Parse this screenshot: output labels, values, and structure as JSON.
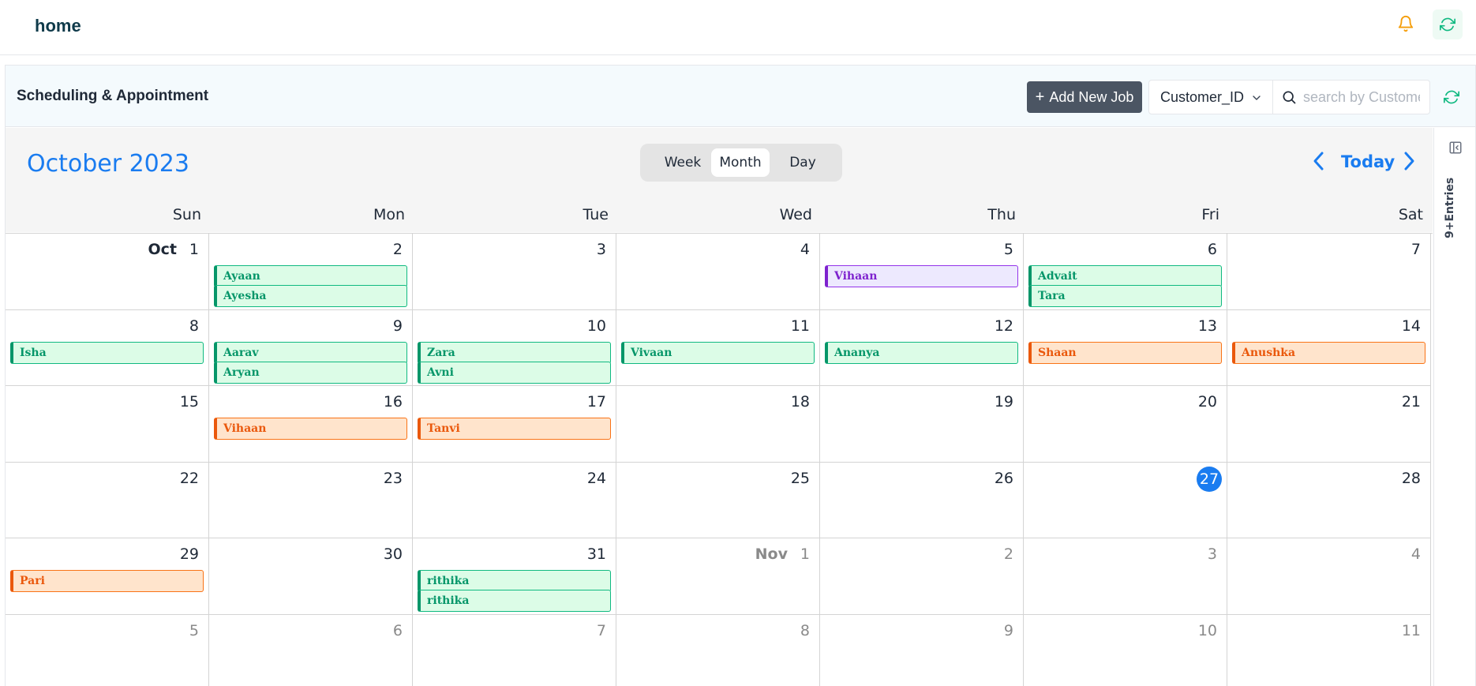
{
  "header": {
    "title": "home",
    "bell_icon": "bell-icon",
    "refresh_icon": "refresh-icon"
  },
  "card": {
    "title": "Scheduling & Appointment",
    "add_button_label": "Add New Job",
    "add_button_icon": "+",
    "filter_select_value": "Customer_ID",
    "search_placeholder": "search by Customer",
    "refresh_icon": "refresh-icon"
  },
  "calendar": {
    "month_title": "October 2023",
    "views": [
      "Week",
      "Month",
      "Day"
    ],
    "active_view": "Month",
    "today_label": "Today",
    "weekdays": [
      "Sun",
      "Mon",
      "Tue",
      "Wed",
      "Thu",
      "Fri",
      "Sat"
    ],
    "weeks": [
      [
        {
          "day": "1",
          "month_label": "Oct",
          "dim": false,
          "events": []
        },
        {
          "day": "2",
          "dim": false,
          "events": [
            {
              "name": "Ayaan",
              "color": "green"
            },
            {
              "name": "Ayesha",
              "color": "green"
            }
          ]
        },
        {
          "day": "3",
          "dim": false,
          "events": []
        },
        {
          "day": "4",
          "dim": false,
          "events": []
        },
        {
          "day": "5",
          "dim": false,
          "events": [
            {
              "name": "Vihaan",
              "color": "purple"
            }
          ]
        },
        {
          "day": "6",
          "dim": false,
          "events": [
            {
              "name": "Advait",
              "color": "green"
            },
            {
              "name": "Tara",
              "color": "green"
            }
          ]
        },
        {
          "day": "7",
          "dim": false,
          "events": []
        }
      ],
      [
        {
          "day": "8",
          "dim": false,
          "events": [
            {
              "name": "Isha",
              "color": "green"
            }
          ]
        },
        {
          "day": "9",
          "dim": false,
          "events": [
            {
              "name": "Aarav",
              "color": "green"
            },
            {
              "name": "Aryan",
              "color": "green"
            }
          ]
        },
        {
          "day": "10",
          "dim": false,
          "events": [
            {
              "name": "Zara",
              "color": "green"
            },
            {
              "name": "Avni",
              "color": "green"
            }
          ]
        },
        {
          "day": "11",
          "dim": false,
          "events": [
            {
              "name": "Vivaan",
              "color": "green"
            }
          ]
        },
        {
          "day": "12",
          "dim": false,
          "events": [
            {
              "name": "Ananya",
              "color": "green"
            }
          ]
        },
        {
          "day": "13",
          "dim": false,
          "events": [
            {
              "name": "Shaan",
              "color": "orange"
            }
          ]
        },
        {
          "day": "14",
          "dim": false,
          "events": [
            {
              "name": "Anushka",
              "color": "orange"
            }
          ]
        }
      ],
      [
        {
          "day": "15",
          "dim": false,
          "events": []
        },
        {
          "day": "16",
          "dim": false,
          "events": [
            {
              "name": "Vihaan",
              "color": "orange"
            }
          ]
        },
        {
          "day": "17",
          "dim": false,
          "events": [
            {
              "name": "Tanvi",
              "color": "orange"
            }
          ]
        },
        {
          "day": "18",
          "dim": false,
          "events": []
        },
        {
          "day": "19",
          "dim": false,
          "events": []
        },
        {
          "day": "20",
          "dim": false,
          "events": []
        },
        {
          "day": "21",
          "dim": false,
          "events": []
        }
      ],
      [
        {
          "day": "22",
          "dim": false,
          "events": []
        },
        {
          "day": "23",
          "dim": false,
          "events": []
        },
        {
          "day": "24",
          "dim": false,
          "events": []
        },
        {
          "day": "25",
          "dim": false,
          "events": []
        },
        {
          "day": "26",
          "dim": false,
          "events": []
        },
        {
          "day": "27",
          "dim": false,
          "today": true,
          "events": []
        },
        {
          "day": "28",
          "dim": false,
          "events": []
        }
      ],
      [
        {
          "day": "29",
          "dim": false,
          "events": [
            {
              "name": "Pari",
              "color": "orange"
            }
          ]
        },
        {
          "day": "30",
          "dim": false,
          "events": []
        },
        {
          "day": "31",
          "dim": false,
          "events": [
            {
              "name": "rithika",
              "color": "green"
            },
            {
              "name": "rithika",
              "color": "green"
            }
          ]
        },
        {
          "day": "1",
          "month_label": "Nov",
          "dim": true,
          "events": []
        },
        {
          "day": "2",
          "dim": true,
          "events": []
        },
        {
          "day": "3",
          "dim": true,
          "events": []
        },
        {
          "day": "4",
          "dim": true,
          "events": []
        }
      ],
      [
        {
          "day": "5",
          "dim": true,
          "events": []
        },
        {
          "day": "6",
          "dim": true,
          "events": []
        },
        {
          "day": "7",
          "dim": true,
          "events": []
        },
        {
          "day": "8",
          "dim": true,
          "events": []
        },
        {
          "day": "9",
          "dim": true,
          "events": []
        },
        {
          "day": "10",
          "dim": true,
          "events": []
        },
        {
          "day": "11",
          "dim": true,
          "events": []
        }
      ]
    ]
  },
  "side_panel": {
    "label": "9+Entries",
    "toggle_icon": "panel-collapse-icon"
  },
  "colors": {
    "accent": "#1a7cf0",
    "green": "#059669",
    "orange": "#ea580c",
    "purple": "#7e22ce",
    "button_dark": "#4b5563"
  }
}
